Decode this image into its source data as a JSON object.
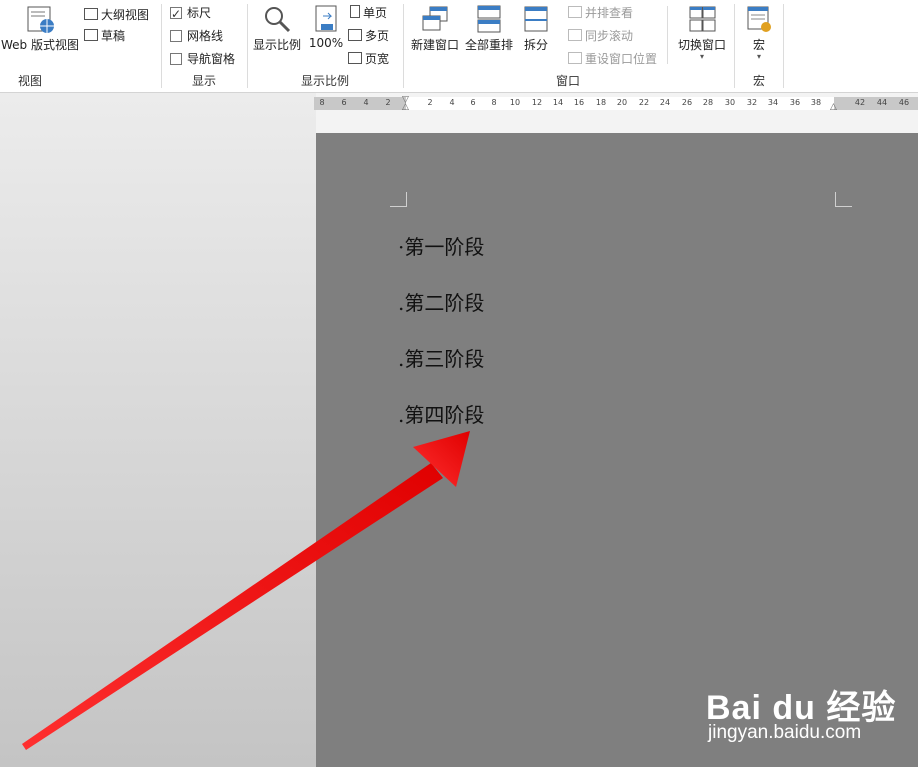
{
  "ribbon": {
    "view_group": {
      "web_layout": "Web 版式视图",
      "outline": "大纲视图",
      "draft": "草稿",
      "label": "视图"
    },
    "show_group": {
      "ruler": "标尺",
      "ruler_checked": true,
      "gridlines": "网格线",
      "gridlines_checked": false,
      "nav_pane": "导航窗格",
      "nav_pane_checked": false,
      "label": "显示"
    },
    "zoom_group": {
      "zoom": "显示比例",
      "hundred": "100%",
      "one_page": "单页",
      "multi_page": "多页",
      "page_width": "页宽",
      "label": "显示比例"
    },
    "window_group": {
      "new_window": "新建窗口",
      "arrange_all": "全部重排",
      "split": "拆分",
      "side_by_side": "并排查看",
      "sync_scroll": "同步滚动",
      "reset_position": "重设窗口位置",
      "switch_windows": "切换窗口",
      "label": "窗口"
    },
    "macro_group": {
      "macros": "宏",
      "label": "宏"
    }
  },
  "ruler": {
    "ticks": [
      "8",
      "6",
      "4",
      "2",
      "2",
      "4",
      "6",
      "8",
      "10",
      "12",
      "14",
      "16",
      "18",
      "20",
      "22",
      "24",
      "26",
      "28",
      "30",
      "32",
      "34",
      "36",
      "38",
      "42",
      "44",
      "46"
    ]
  },
  "document": {
    "paragraphs": [
      "·第一阶段",
      ".第二阶段",
      ".第三阶段",
      ".第四阶段"
    ]
  },
  "watermark": {
    "logo": "Bai du 经验",
    "url": "jingyan.baidu.com"
  },
  "colors": {
    "arrow": "#ff1a1a",
    "page": "#7f7f7f"
  }
}
